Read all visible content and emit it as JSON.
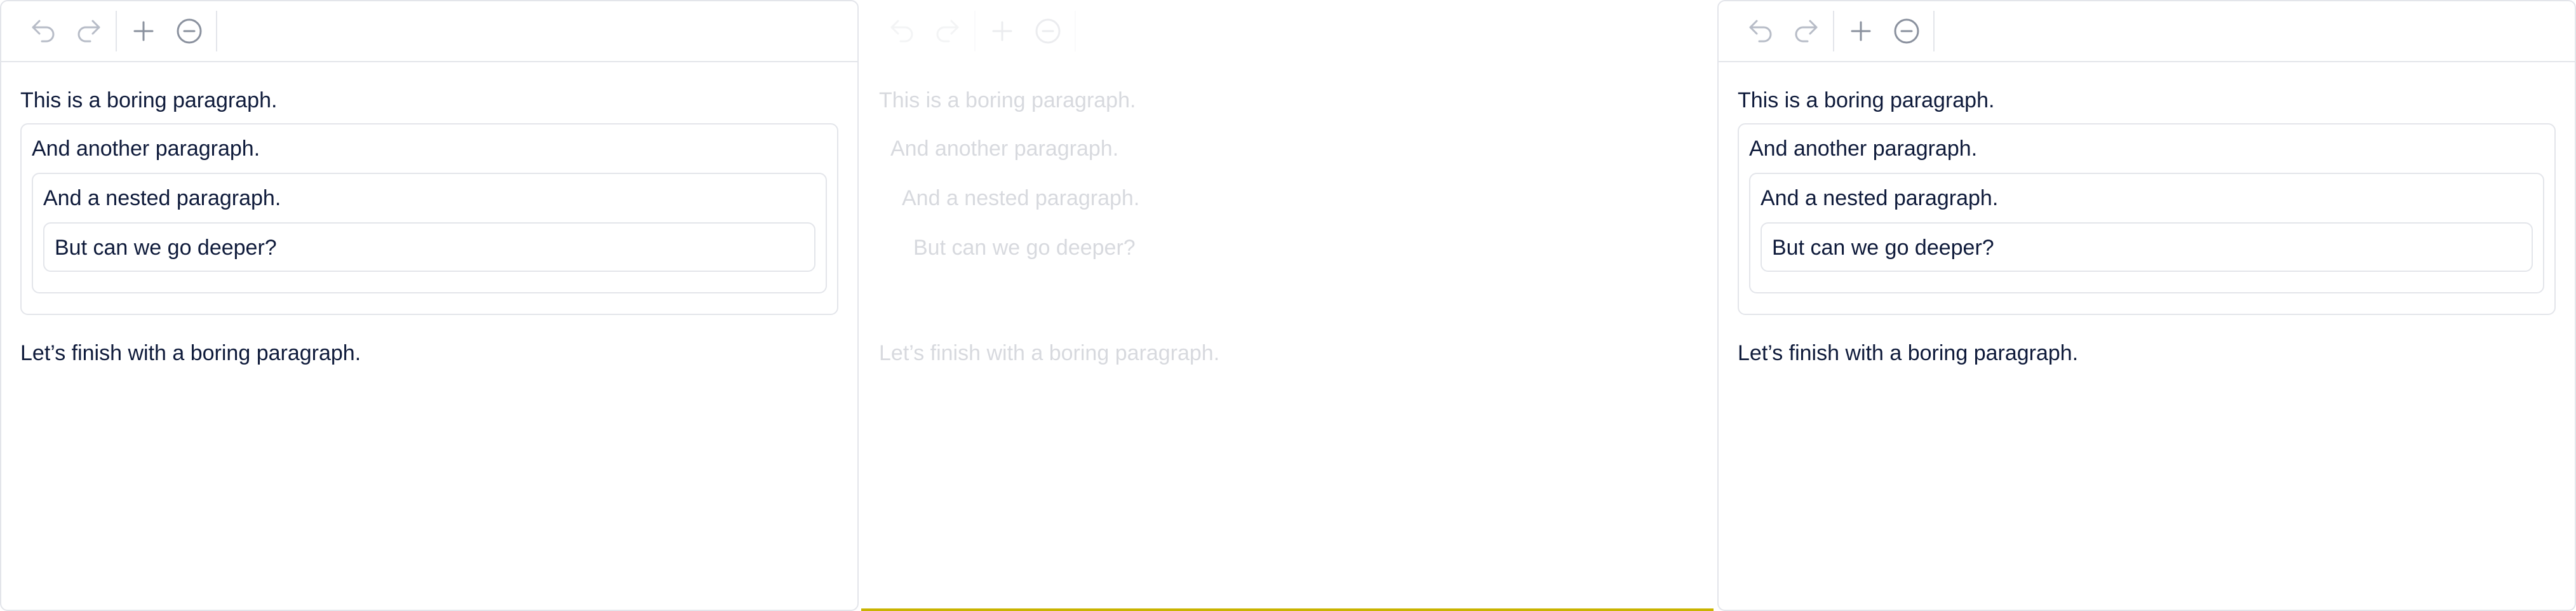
{
  "toolbar": {
    "undo_icon": "undo-icon",
    "redo_icon": "redo-icon",
    "add_icon": "plus-icon",
    "remove_icon": "minus-circle-icon"
  },
  "editors": [
    {
      "p1": "This is a boring paragraph.",
      "p2": "And another paragraph.",
      "p3": "And a nested paragraph.",
      "p4": "But can we go deeper?",
      "p5": "Let’s finish with a boring paragraph."
    },
    {
      "p1": "This is a boring paragraph.",
      "p2": "And another paragraph.",
      "p3": "And a nested paragraph.",
      "p4": "But can we go deeper?",
      "p5": "Let’s finish with a boring paragraph."
    },
    {
      "p1": "This is a boring paragraph.",
      "p2": "And another paragraph.",
      "p3": "And a nested paragraph.",
      "p4": "But can we go deeper?",
      "p5": "Let’s finish with a boring paragraph."
    }
  ],
  "colors": {
    "border": "#e3e5ea",
    "text": "#0e1a3a",
    "icon_muted": "#b7bcc7",
    "icon_active": "#8a919e",
    "accent_line": "#c9b400"
  }
}
